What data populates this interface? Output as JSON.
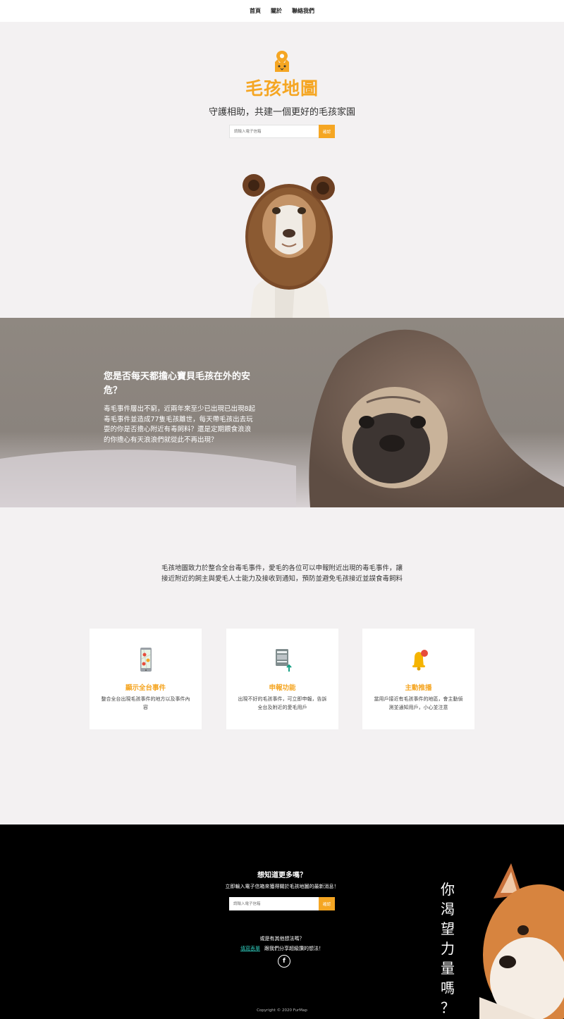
{
  "nav": {
    "items": [
      "首頁",
      "關於",
      "聯絡我們"
    ]
  },
  "hero": {
    "brand": "毛孩地圖",
    "slogan": "守護相助，共建一個更好的毛孩家園",
    "email_placeholder": "請輸入電子信箱",
    "submit_label": "確認"
  },
  "band": {
    "title": "您是否每天都擔心寶貝毛孩在外的安危？",
    "text": "毒毛事件層出不窮，近兩年來至少已出現已出現8起毒毛事件並造成77隻毛孩離世，每天帶毛孩出去玩耍的你是否擔心附近有毒飼料？還是定期餵食浪浪的你擔心有天浪浪們就從此不再出現？"
  },
  "about": {
    "text": "毛孩地圖致力於整合全台毒毛事件，愛毛的各位可以申報附近出現的毒毛事件，讓接近附近的飼主與愛毛人士能力及接收到通知，預防並避免毛孩接近並誤食毒飼料",
    "cards": [
      {
        "icon": "map-phone-icon",
        "title": "顯示全台事件",
        "desc": "整合全台出現毛孩事件的地方以及事件內容"
      },
      {
        "icon": "report-upload-icon",
        "title": "申報功能",
        "desc": "出現不好的毛孩事件，可立即申報，告訴全台及附近的愛毛用戶"
      },
      {
        "icon": "notification-bell-icon",
        "title": "主動推播",
        "desc": "當用戶接近有毛孩事件的地區，會主動偵測並通知用戶，小心並注意"
      }
    ]
  },
  "footer": {
    "title": "想知道更多嗎？",
    "subtitle": "立即輸入電子信箱來獲得關於毛孩地圖的最新消息！",
    "email_placeholder": "請輸入電子信箱",
    "submit_label": "確認",
    "question": "或是有其他想法嗎？",
    "form_link": "填寫表單",
    "share_text": "跟我們分享超級讚的想法！",
    "social_icon": "facebook-icon",
    "vertical_text": [
      "你",
      "渴",
      "望",
      "力",
      "量",
      "嗎",
      "？"
    ],
    "copyright": "Copyright © 2020 FurMap"
  },
  "colors": {
    "accent": "#f5a623",
    "link": "#2ec4b6",
    "footer_bg": "#000000",
    "page_bg": "#f3f1f2"
  }
}
